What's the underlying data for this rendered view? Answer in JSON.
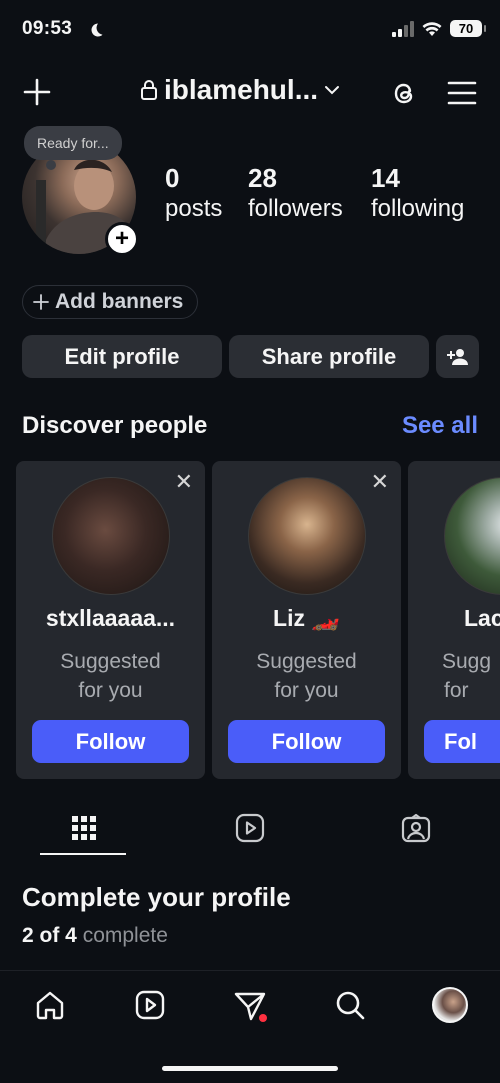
{
  "status_bar": {
    "time": "09:53",
    "battery": "70"
  },
  "header": {
    "username": "iblamehul...",
    "icons": [
      "plus-icon",
      "lock-icon",
      "chevron-down-icon",
      "threads-icon",
      "menu-icon"
    ]
  },
  "profile": {
    "note": "Ready for...",
    "stats": [
      {
        "value": "0",
        "label": "posts"
      },
      {
        "value": "28",
        "label": "followers"
      },
      {
        "value": "14",
        "label": "following"
      }
    ],
    "add_banners_label": "Add banners",
    "edit_profile_label": "Edit profile",
    "share_profile_label": "Share profile"
  },
  "discover": {
    "title": "Discover people",
    "see_all_label": "See all",
    "cards": [
      {
        "name": "stxllaaaaa...",
        "subtitle_line1": "Suggested",
        "subtitle_line2": "for you",
        "follow_label": "Follow"
      },
      {
        "name": "Liz 🏎️",
        "subtitle_line1": "Suggested",
        "subtitle_line2": "for you",
        "follow_label": "Follow"
      },
      {
        "name": "Lac",
        "subtitle_line1": "Sugg",
        "subtitle_line2": "for",
        "follow_label": "Fol"
      }
    ]
  },
  "tabs": [
    "grid-icon",
    "reels-icon",
    "tagged-icon"
  ],
  "complete_profile": {
    "title": "Complete your profile",
    "progress_strong": "2 of 4",
    "progress_rest": "complete"
  },
  "bottom_nav": [
    "home-icon",
    "reels-icon",
    "send-icon",
    "search-icon",
    "profile-avatar"
  ],
  "colors": {
    "background": "#0c0f14",
    "accent_blue": "#4a5df9",
    "link_blue": "#6b8bff",
    "notification_dot": "#ff3040"
  }
}
